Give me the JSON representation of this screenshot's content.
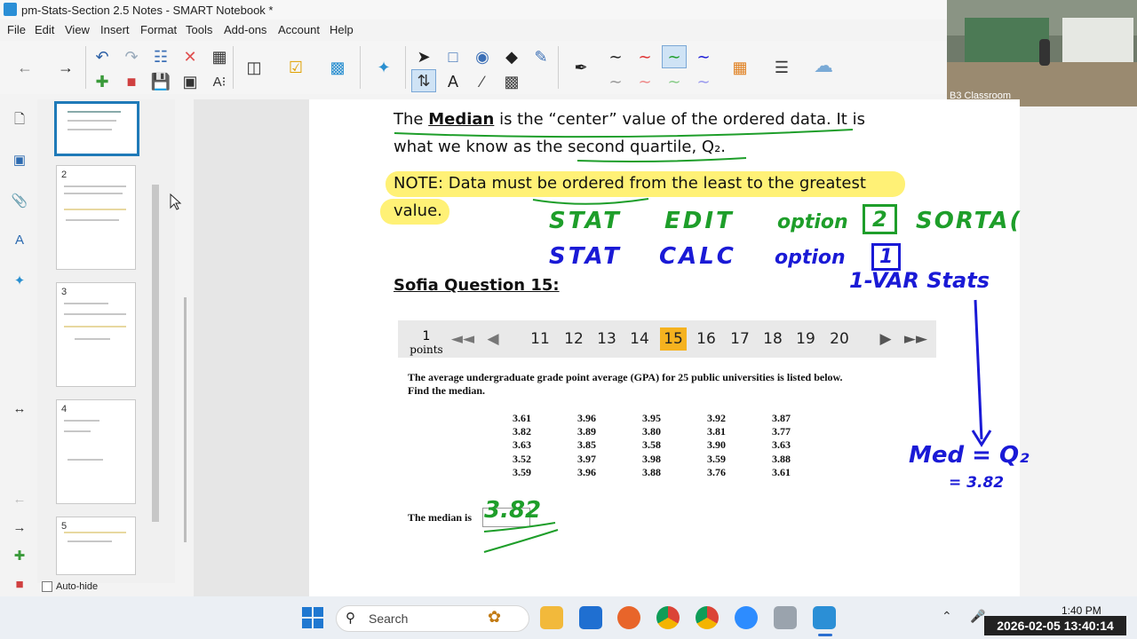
{
  "window": {
    "title": "pm-Stats-Section 2.5 Notes - SMART Notebook *"
  },
  "menu": [
    "File",
    "Edit",
    "View",
    "Insert",
    "Format",
    "Tools",
    "Add-ons",
    "Account",
    "Help"
  ],
  "webcam": {
    "label": "B3 Classroom"
  },
  "sorter": {
    "pages": [
      "2",
      "3",
      "4",
      "5"
    ],
    "autohide_label": "Auto-hide"
  },
  "notes": {
    "median_pre": "The ",
    "median_word": "Median",
    "median_post": " is the “center” value of the ordered data.  It is",
    "line2_pre": "what we know as the ",
    "line2_u": "second quartile",
    "line2_post": ", Q₂.",
    "note1": "NOTE: Data must be ordered from the least to the greatest",
    "note2": "value.",
    "question_heading": "Sofia Question 15:"
  },
  "question": {
    "points_value": "1",
    "points_label": "points",
    "pages": [
      "11",
      "12",
      "13",
      "14",
      "15",
      "16",
      "17",
      "18",
      "19",
      "20"
    ],
    "current_page": "15",
    "prompt_line1": "The average undergraduate grade point average (GPA) for 25 public universities is listed below.",
    "prompt_line2": "Find the median.",
    "gpa_columns": [
      [
        "3.61",
        "3.82",
        "3.63",
        "3.52",
        "3.59"
      ],
      [
        "3.96",
        "3.89",
        "3.85",
        "3.97",
        "3.96"
      ],
      [
        "3.95",
        "3.80",
        "3.58",
        "3.98",
        "3.88"
      ],
      [
        "3.92",
        "3.81",
        "3.90",
        "3.59",
        "3.76"
      ],
      [
        "3.87",
        "3.77",
        "3.63",
        "3.88",
        "3.61"
      ]
    ],
    "answer_label": "The median is",
    "answer_value": "3.82"
  },
  "handwriting": {
    "line1_a": "STAT",
    "line1_b": "EDIT",
    "line1_c": "option",
    "line1_box": "2",
    "line1_d": "SORTA(",
    "line2_a": "STAT",
    "line2_b": "CALC",
    "line2_c": "option",
    "line2_box": "1",
    "onevar": "1-VAR Stats",
    "med_label": "Med = Q₂",
    "med_value": "= 3.82"
  },
  "taskbar": {
    "search_placeholder": "Search",
    "time": "1:40 PM",
    "timestamp": "2026-02-05  13:40:14"
  },
  "colors": {
    "accent": "#2b8fd6",
    "highlight": "#fff176",
    "page_current": "#f5b21f",
    "ink_green": "#1e9e2a",
    "ink_blue": "#1a1ad6"
  }
}
